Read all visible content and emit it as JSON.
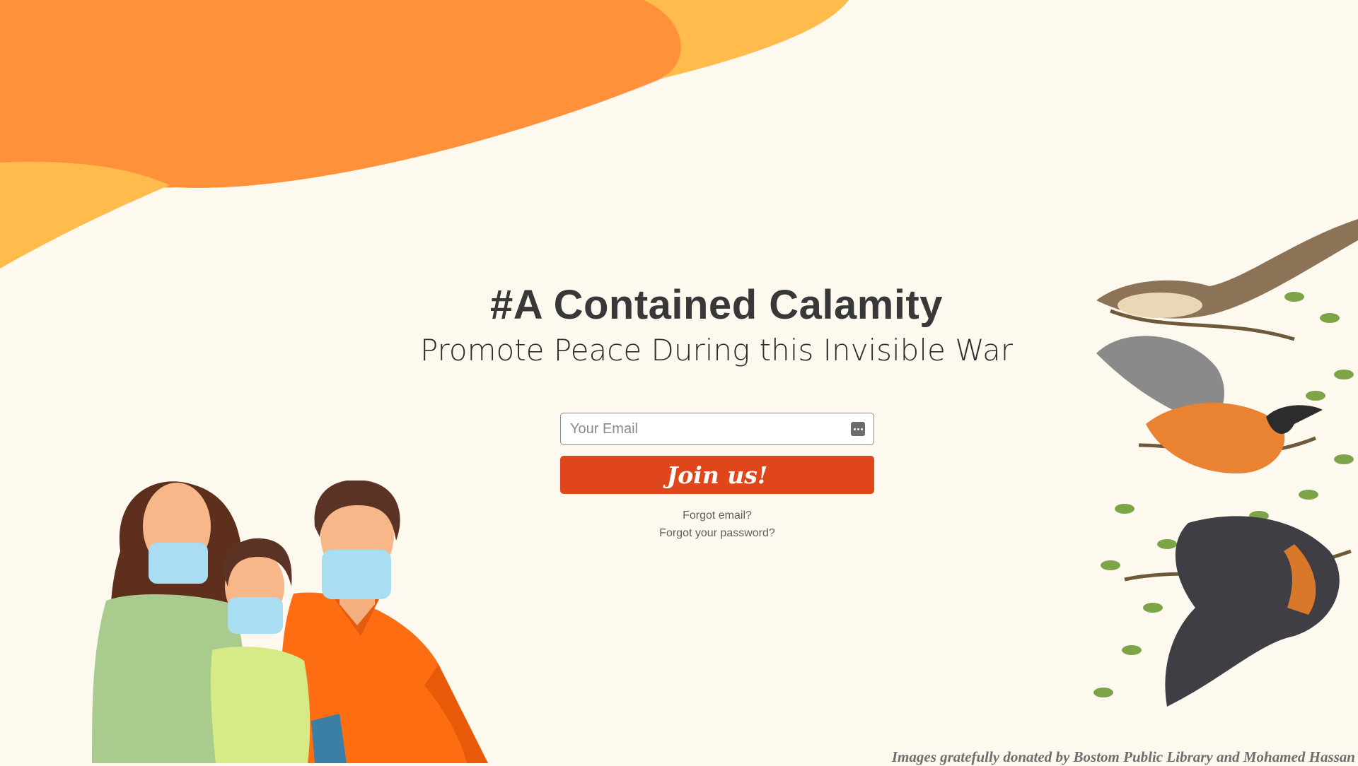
{
  "hero": {
    "title": "#A Contained Calamity",
    "subtitle": "Promote Peace During this Invisible War"
  },
  "signup": {
    "email_placeholder": "Your Email",
    "email_value": "",
    "submit_label": "Join us!",
    "forgot_email_link": "Forgot email?",
    "forgot_password_link": "Forgot your password?"
  },
  "footer": {
    "credit": "Images gratefully donated by Bostom Public Library and Mohamed Hassan"
  },
  "illustrations": {
    "top_left": "decorative-orange-waves",
    "bottom_left": "masked-family",
    "right": "birds-on-branch"
  },
  "colors": {
    "background": "#fdf9ef",
    "wave_orange": "#ff913a",
    "wave_yellow": "#ffbb4c",
    "wave_pink": "#ffbfb4",
    "button": "#e0461b",
    "title_text": "#383838"
  },
  "icons": {
    "email_field": "password-manager-icon"
  }
}
